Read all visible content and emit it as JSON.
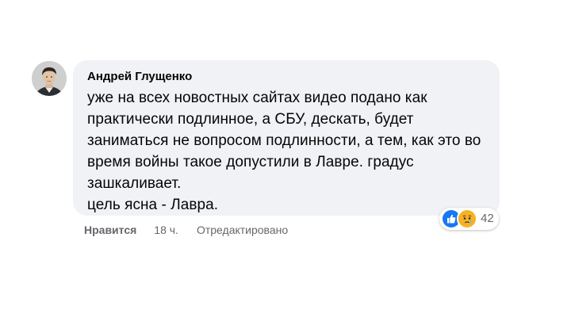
{
  "comment": {
    "author": "Андрей Глущенко",
    "text": "уже на всех новостных сайтах видео подано как практически подлинное, а СБУ, дескать, будет заниматься не вопросом подлинности, а тем, как это во время войны такое допустили в Лавре. градус зашкаливает.\nцель ясна - Лавра.",
    "reactions": {
      "icons": [
        "like-icon",
        "sad-icon"
      ],
      "count": "42"
    },
    "actions": {
      "like_label": "Нравится",
      "time": "18 ч.",
      "edited_label": "Отредактировано"
    }
  },
  "colors": {
    "bubble_bg": "#f0f2f5",
    "text": "#050505",
    "meta": "#65676b",
    "like_blue": "#1877f2",
    "sad_yellow": "#f7b125"
  }
}
